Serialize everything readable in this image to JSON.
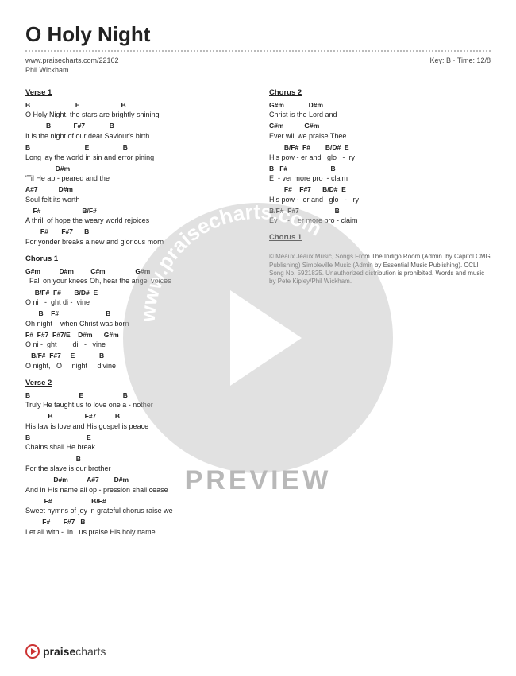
{
  "title": "O Holy Night",
  "url": "www.praisecharts.com/22162",
  "key_time": "Key: B · Time: 12/8",
  "artist": "Phil Wickham",
  "watermark_url": "www.praisecharts.com",
  "preview_label": "PREVIEW",
  "footer_brand_bold": "praise",
  "footer_brand_light": "charts",
  "left": {
    "verse1": {
      "title": "Verse 1",
      "l1c": "B                        E                      B",
      "l1": "O Holy Night, the stars are brightly shining",
      "l2c": "           B            F#7             B",
      "l2": "It is the night of our dear Saviour's birth",
      "l3c": "B                             E                  B",
      "l3": "Long lay the world in sin and error pining",
      "l4c": "                D#m",
      "l4": "'Til He ap - peared and the",
      "l5c": "A#7           D#m",
      "l5": "Soul felt its worth",
      "l6c": "    F#                      B/F#",
      "l6": "A thrill of hope the weary world rejoices",
      "l7c": "        F#       F#7      B",
      "l7": "For yonder breaks a new and glorious morn"
    },
    "chorus1": {
      "title": "Chorus 1",
      "l1c": "G#m          D#m         C#m                G#m",
      "l1": "  Fall on your knees Oh, hear the angel voices",
      "l2c": "     B/F#  F#       B/D#  E",
      "l2": "O ni   -  ght di -  vine",
      "l3c": "       B    F#                         B",
      "l3": "Oh night    when Christ was born",
      "l4c": "F#  F#7  F#7/E    D#m      G#m",
      "l4": "O ni -  ght        di   -   vine",
      "l5c": "   B/F#  F#7     E             B",
      "l5": "O night,   O     night     divine"
    },
    "verse2": {
      "title": "Verse 2",
      "l1c": "B                          E                     B",
      "l1": "Truly He taught us to love one a - nother",
      "l2c": "            B                 F#7          B",
      "l2": "His law is love and His gospel is peace",
      "l3c": "B                              E",
      "l3": "Chains shall He break",
      "l4c": "                           B",
      "l4": "For the slave is our brother",
      "l5c": "               D#m          A#7        D#m",
      "l5": "And in His name all op - pression shall cease",
      "l6c": "          F#                     B/F#",
      "l6": "Sweet hymns of joy in grateful chorus raise we",
      "l7c": "         F#       F#7   B",
      "l7": "Let all with -  in   us praise His holy name"
    }
  },
  "right": {
    "chorus2": {
      "title": "Chorus 2",
      "l1c": "G#m             D#m",
      "l1": "Christ is the Lord and",
      "l2c": "C#m           G#m",
      "l2": "Ever will we praise Thee",
      "l3c": "        B/F#  F#        B/D#  E",
      "l3": "His pow - er and   glo   -  ry",
      "l4c": "B   F#                       B",
      "l4": "E  - ver more pro  - claim",
      "l5c": "        F#    F#7      B/D#  E",
      "l5": "His pow -  er and   glo   -   ry",
      "l6c": "B/F#  F#7                   B",
      "l6": "Ev     -    er more pro - claim"
    },
    "chorus1_repeat": {
      "title": "Chorus 1"
    },
    "copyright": "© Meaux Jeaux Music, Songs From The Indigo Room (Admin. by Capitol CMG Publishing) Simpleville Music (Admin by Essential Music Publishing). CCLI Song No. 5921825. Unauthorized distribution is prohibited. Words and music by Pete Kipley/Phil Wickham."
  }
}
